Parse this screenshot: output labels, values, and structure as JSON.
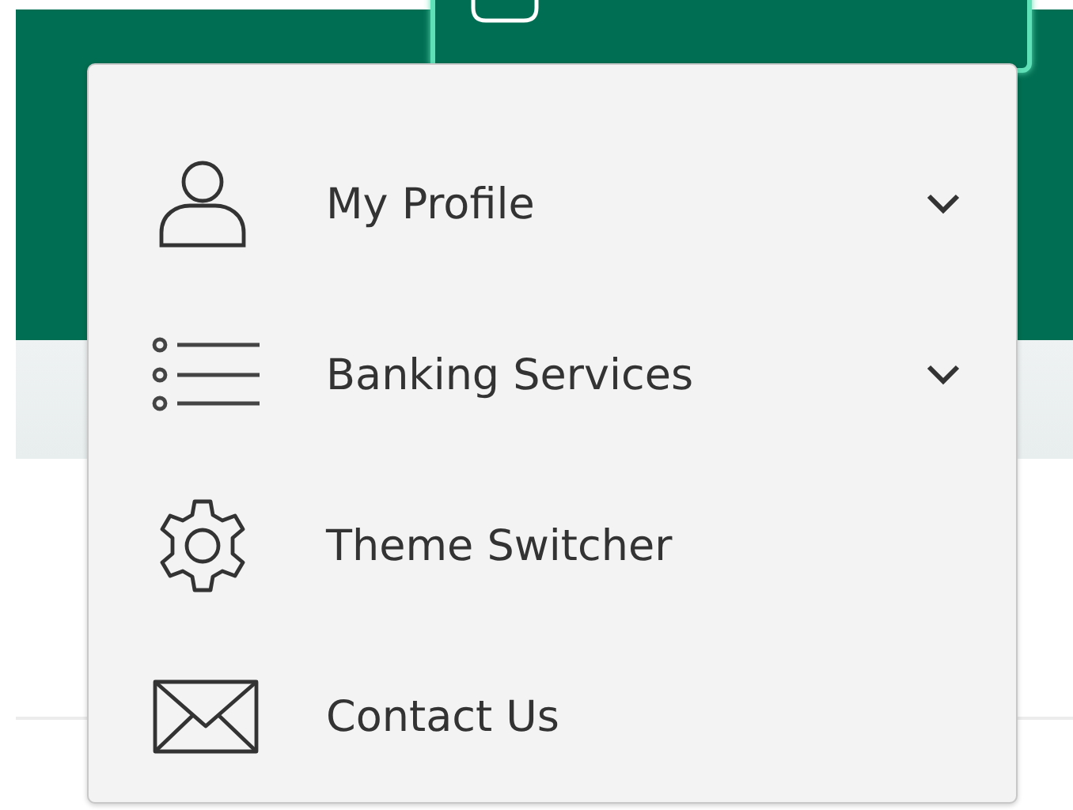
{
  "menu": {
    "items": [
      {
        "label": "My Profile",
        "kind": "submenu"
      },
      {
        "label": "Banking Services",
        "kind": "submenu"
      },
      {
        "label": "Theme Switcher",
        "kind": "link"
      },
      {
        "label": "Contact Us",
        "kind": "link"
      }
    ]
  }
}
